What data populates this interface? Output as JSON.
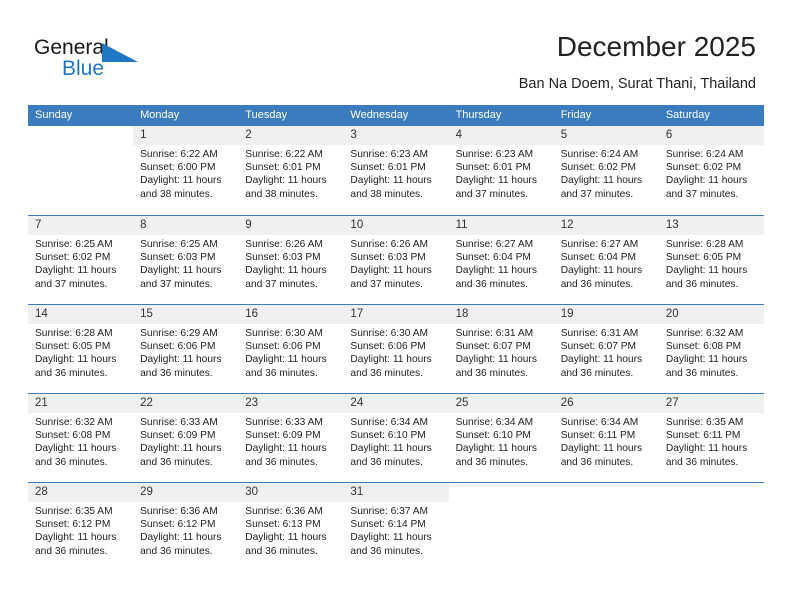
{
  "brand": {
    "name_dark": "General",
    "name_blue": "Blue",
    "accent_color": "#1f77c4"
  },
  "header": {
    "title": "December 2025",
    "subtitle": "Ban Na Doem, Surat Thani, Thailand"
  },
  "calendar": {
    "header_bg": "#3a7cbe",
    "daynum_bg": "#f0f0f0",
    "weekdays": [
      "Sunday",
      "Monday",
      "Tuesday",
      "Wednesday",
      "Thursday",
      "Friday",
      "Saturday"
    ],
    "labels": {
      "sunrise": "Sunrise:",
      "sunset": "Sunset:",
      "daylight": "Daylight:"
    },
    "weeks": [
      [
        {
          "day": ""
        },
        {
          "day": "1",
          "sunrise": "Sunrise: 6:22 AM",
          "sunset": "Sunset: 6:00 PM",
          "daylight": "Daylight: 11 hours and 38 minutes."
        },
        {
          "day": "2",
          "sunrise": "Sunrise: 6:22 AM",
          "sunset": "Sunset: 6:01 PM",
          "daylight": "Daylight: 11 hours and 38 minutes."
        },
        {
          "day": "3",
          "sunrise": "Sunrise: 6:23 AM",
          "sunset": "Sunset: 6:01 PM",
          "daylight": "Daylight: 11 hours and 38 minutes."
        },
        {
          "day": "4",
          "sunrise": "Sunrise: 6:23 AM",
          "sunset": "Sunset: 6:01 PM",
          "daylight": "Daylight: 11 hours and 37 minutes."
        },
        {
          "day": "5",
          "sunrise": "Sunrise: 6:24 AM",
          "sunset": "Sunset: 6:02 PM",
          "daylight": "Daylight: 11 hours and 37 minutes."
        },
        {
          "day": "6",
          "sunrise": "Sunrise: 6:24 AM",
          "sunset": "Sunset: 6:02 PM",
          "daylight": "Daylight: 11 hours and 37 minutes."
        }
      ],
      [
        {
          "day": "7",
          "sunrise": "Sunrise: 6:25 AM",
          "sunset": "Sunset: 6:02 PM",
          "daylight": "Daylight: 11 hours and 37 minutes."
        },
        {
          "day": "8",
          "sunrise": "Sunrise: 6:25 AM",
          "sunset": "Sunset: 6:03 PM",
          "daylight": "Daylight: 11 hours and 37 minutes."
        },
        {
          "day": "9",
          "sunrise": "Sunrise: 6:26 AM",
          "sunset": "Sunset: 6:03 PM",
          "daylight": "Daylight: 11 hours and 37 minutes."
        },
        {
          "day": "10",
          "sunrise": "Sunrise: 6:26 AM",
          "sunset": "Sunset: 6:03 PM",
          "daylight": "Daylight: 11 hours and 37 minutes."
        },
        {
          "day": "11",
          "sunrise": "Sunrise: 6:27 AM",
          "sunset": "Sunset: 6:04 PM",
          "daylight": "Daylight: 11 hours and 36 minutes."
        },
        {
          "day": "12",
          "sunrise": "Sunrise: 6:27 AM",
          "sunset": "Sunset: 6:04 PM",
          "daylight": "Daylight: 11 hours and 36 minutes."
        },
        {
          "day": "13",
          "sunrise": "Sunrise: 6:28 AM",
          "sunset": "Sunset: 6:05 PM",
          "daylight": "Daylight: 11 hours and 36 minutes."
        }
      ],
      [
        {
          "day": "14",
          "sunrise": "Sunrise: 6:28 AM",
          "sunset": "Sunset: 6:05 PM",
          "daylight": "Daylight: 11 hours and 36 minutes."
        },
        {
          "day": "15",
          "sunrise": "Sunrise: 6:29 AM",
          "sunset": "Sunset: 6:06 PM",
          "daylight": "Daylight: 11 hours and 36 minutes."
        },
        {
          "day": "16",
          "sunrise": "Sunrise: 6:30 AM",
          "sunset": "Sunset: 6:06 PM",
          "daylight": "Daylight: 11 hours and 36 minutes."
        },
        {
          "day": "17",
          "sunrise": "Sunrise: 6:30 AM",
          "sunset": "Sunset: 6:06 PM",
          "daylight": "Daylight: 11 hours and 36 minutes."
        },
        {
          "day": "18",
          "sunrise": "Sunrise: 6:31 AM",
          "sunset": "Sunset: 6:07 PM",
          "daylight": "Daylight: 11 hours and 36 minutes."
        },
        {
          "day": "19",
          "sunrise": "Sunrise: 6:31 AM",
          "sunset": "Sunset: 6:07 PM",
          "daylight": "Daylight: 11 hours and 36 minutes."
        },
        {
          "day": "20",
          "sunrise": "Sunrise: 6:32 AM",
          "sunset": "Sunset: 6:08 PM",
          "daylight": "Daylight: 11 hours and 36 minutes."
        }
      ],
      [
        {
          "day": "21",
          "sunrise": "Sunrise: 6:32 AM",
          "sunset": "Sunset: 6:08 PM",
          "daylight": "Daylight: 11 hours and 36 minutes."
        },
        {
          "day": "22",
          "sunrise": "Sunrise: 6:33 AM",
          "sunset": "Sunset: 6:09 PM",
          "daylight": "Daylight: 11 hours and 36 minutes."
        },
        {
          "day": "23",
          "sunrise": "Sunrise: 6:33 AM",
          "sunset": "Sunset: 6:09 PM",
          "daylight": "Daylight: 11 hours and 36 minutes."
        },
        {
          "day": "24",
          "sunrise": "Sunrise: 6:34 AM",
          "sunset": "Sunset: 6:10 PM",
          "daylight": "Daylight: 11 hours and 36 minutes."
        },
        {
          "day": "25",
          "sunrise": "Sunrise: 6:34 AM",
          "sunset": "Sunset: 6:10 PM",
          "daylight": "Daylight: 11 hours and 36 minutes."
        },
        {
          "day": "26",
          "sunrise": "Sunrise: 6:34 AM",
          "sunset": "Sunset: 6:11 PM",
          "daylight": "Daylight: 11 hours and 36 minutes."
        },
        {
          "day": "27",
          "sunrise": "Sunrise: 6:35 AM",
          "sunset": "Sunset: 6:11 PM",
          "daylight": "Daylight: 11 hours and 36 minutes."
        }
      ],
      [
        {
          "day": "28",
          "sunrise": "Sunrise: 6:35 AM",
          "sunset": "Sunset: 6:12 PM",
          "daylight": "Daylight: 11 hours and 36 minutes."
        },
        {
          "day": "29",
          "sunrise": "Sunrise: 6:36 AM",
          "sunset": "Sunset: 6:12 PM",
          "daylight": "Daylight: 11 hours and 36 minutes."
        },
        {
          "day": "30",
          "sunrise": "Sunrise: 6:36 AM",
          "sunset": "Sunset: 6:13 PM",
          "daylight": "Daylight: 11 hours and 36 minutes."
        },
        {
          "day": "31",
          "sunrise": "Sunrise: 6:37 AM",
          "sunset": "Sunset: 6:14 PM",
          "daylight": "Daylight: 11 hours and 36 minutes."
        },
        {
          "day": ""
        },
        {
          "day": ""
        },
        {
          "day": ""
        }
      ]
    ]
  }
}
